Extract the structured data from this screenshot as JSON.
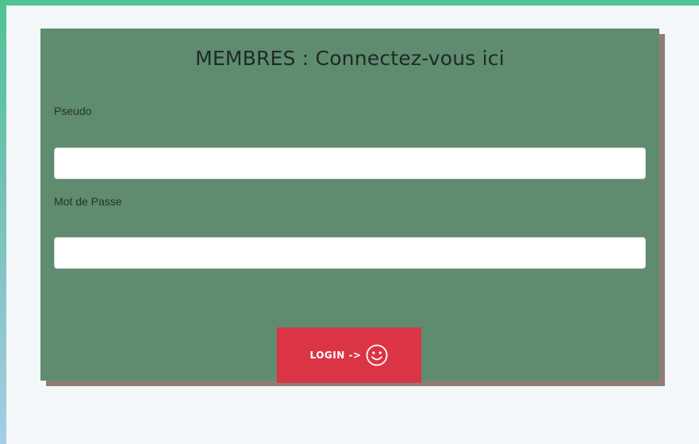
{
  "login_form": {
    "title": "MEMBRES : Connectez-vous ici",
    "pseudo_label": "Pseudo",
    "pseudo_value": "",
    "pseudo_placeholder": "",
    "password_label": "Mot de Passe",
    "password_value": "",
    "password_placeholder": "",
    "submit_label": "LOGIN ->",
    "submit_icon": "smiley-icon"
  },
  "colors": {
    "card_background": "#5f8b6e",
    "card_shadow": "#8d7d76",
    "button_background": "#db3545",
    "page_background": "#f3f7f9",
    "outer_gradient_top": "#4fc394",
    "outer_gradient_bottom": "#a6cde4"
  }
}
